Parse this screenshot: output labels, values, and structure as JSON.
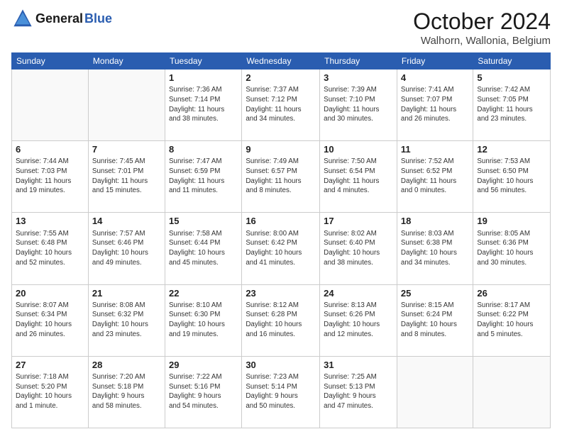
{
  "header": {
    "logo_line1": "General",
    "logo_line2": "Blue",
    "month": "October 2024",
    "location": "Walhorn, Wallonia, Belgium"
  },
  "weekdays": [
    "Sunday",
    "Monday",
    "Tuesday",
    "Wednesday",
    "Thursday",
    "Friday",
    "Saturday"
  ],
  "weeks": [
    [
      {
        "day": "",
        "info": ""
      },
      {
        "day": "",
        "info": ""
      },
      {
        "day": "1",
        "info": "Sunrise: 7:36 AM\nSunset: 7:14 PM\nDaylight: 11 hours\nand 38 minutes."
      },
      {
        "day": "2",
        "info": "Sunrise: 7:37 AM\nSunset: 7:12 PM\nDaylight: 11 hours\nand 34 minutes."
      },
      {
        "day": "3",
        "info": "Sunrise: 7:39 AM\nSunset: 7:10 PM\nDaylight: 11 hours\nand 30 minutes."
      },
      {
        "day": "4",
        "info": "Sunrise: 7:41 AM\nSunset: 7:07 PM\nDaylight: 11 hours\nand 26 minutes."
      },
      {
        "day": "5",
        "info": "Sunrise: 7:42 AM\nSunset: 7:05 PM\nDaylight: 11 hours\nand 23 minutes."
      }
    ],
    [
      {
        "day": "6",
        "info": "Sunrise: 7:44 AM\nSunset: 7:03 PM\nDaylight: 11 hours\nand 19 minutes."
      },
      {
        "day": "7",
        "info": "Sunrise: 7:45 AM\nSunset: 7:01 PM\nDaylight: 11 hours\nand 15 minutes."
      },
      {
        "day": "8",
        "info": "Sunrise: 7:47 AM\nSunset: 6:59 PM\nDaylight: 11 hours\nand 11 minutes."
      },
      {
        "day": "9",
        "info": "Sunrise: 7:49 AM\nSunset: 6:57 PM\nDaylight: 11 hours\nand 8 minutes."
      },
      {
        "day": "10",
        "info": "Sunrise: 7:50 AM\nSunset: 6:54 PM\nDaylight: 11 hours\nand 4 minutes."
      },
      {
        "day": "11",
        "info": "Sunrise: 7:52 AM\nSunset: 6:52 PM\nDaylight: 11 hours\nand 0 minutes."
      },
      {
        "day": "12",
        "info": "Sunrise: 7:53 AM\nSunset: 6:50 PM\nDaylight: 10 hours\nand 56 minutes."
      }
    ],
    [
      {
        "day": "13",
        "info": "Sunrise: 7:55 AM\nSunset: 6:48 PM\nDaylight: 10 hours\nand 52 minutes."
      },
      {
        "day": "14",
        "info": "Sunrise: 7:57 AM\nSunset: 6:46 PM\nDaylight: 10 hours\nand 49 minutes."
      },
      {
        "day": "15",
        "info": "Sunrise: 7:58 AM\nSunset: 6:44 PM\nDaylight: 10 hours\nand 45 minutes."
      },
      {
        "day": "16",
        "info": "Sunrise: 8:00 AM\nSunset: 6:42 PM\nDaylight: 10 hours\nand 41 minutes."
      },
      {
        "day": "17",
        "info": "Sunrise: 8:02 AM\nSunset: 6:40 PM\nDaylight: 10 hours\nand 38 minutes."
      },
      {
        "day": "18",
        "info": "Sunrise: 8:03 AM\nSunset: 6:38 PM\nDaylight: 10 hours\nand 34 minutes."
      },
      {
        "day": "19",
        "info": "Sunrise: 8:05 AM\nSunset: 6:36 PM\nDaylight: 10 hours\nand 30 minutes."
      }
    ],
    [
      {
        "day": "20",
        "info": "Sunrise: 8:07 AM\nSunset: 6:34 PM\nDaylight: 10 hours\nand 26 minutes."
      },
      {
        "day": "21",
        "info": "Sunrise: 8:08 AM\nSunset: 6:32 PM\nDaylight: 10 hours\nand 23 minutes."
      },
      {
        "day": "22",
        "info": "Sunrise: 8:10 AM\nSunset: 6:30 PM\nDaylight: 10 hours\nand 19 minutes."
      },
      {
        "day": "23",
        "info": "Sunrise: 8:12 AM\nSunset: 6:28 PM\nDaylight: 10 hours\nand 16 minutes."
      },
      {
        "day": "24",
        "info": "Sunrise: 8:13 AM\nSunset: 6:26 PM\nDaylight: 10 hours\nand 12 minutes."
      },
      {
        "day": "25",
        "info": "Sunrise: 8:15 AM\nSunset: 6:24 PM\nDaylight: 10 hours\nand 8 minutes."
      },
      {
        "day": "26",
        "info": "Sunrise: 8:17 AM\nSunset: 6:22 PM\nDaylight: 10 hours\nand 5 minutes."
      }
    ],
    [
      {
        "day": "27",
        "info": "Sunrise: 7:18 AM\nSunset: 5:20 PM\nDaylight: 10 hours\nand 1 minute."
      },
      {
        "day": "28",
        "info": "Sunrise: 7:20 AM\nSunset: 5:18 PM\nDaylight: 9 hours\nand 58 minutes."
      },
      {
        "day": "29",
        "info": "Sunrise: 7:22 AM\nSunset: 5:16 PM\nDaylight: 9 hours\nand 54 minutes."
      },
      {
        "day": "30",
        "info": "Sunrise: 7:23 AM\nSunset: 5:14 PM\nDaylight: 9 hours\nand 50 minutes."
      },
      {
        "day": "31",
        "info": "Sunrise: 7:25 AM\nSunset: 5:13 PM\nDaylight: 9 hours\nand 47 minutes."
      },
      {
        "day": "",
        "info": ""
      },
      {
        "day": "",
        "info": ""
      }
    ]
  ]
}
